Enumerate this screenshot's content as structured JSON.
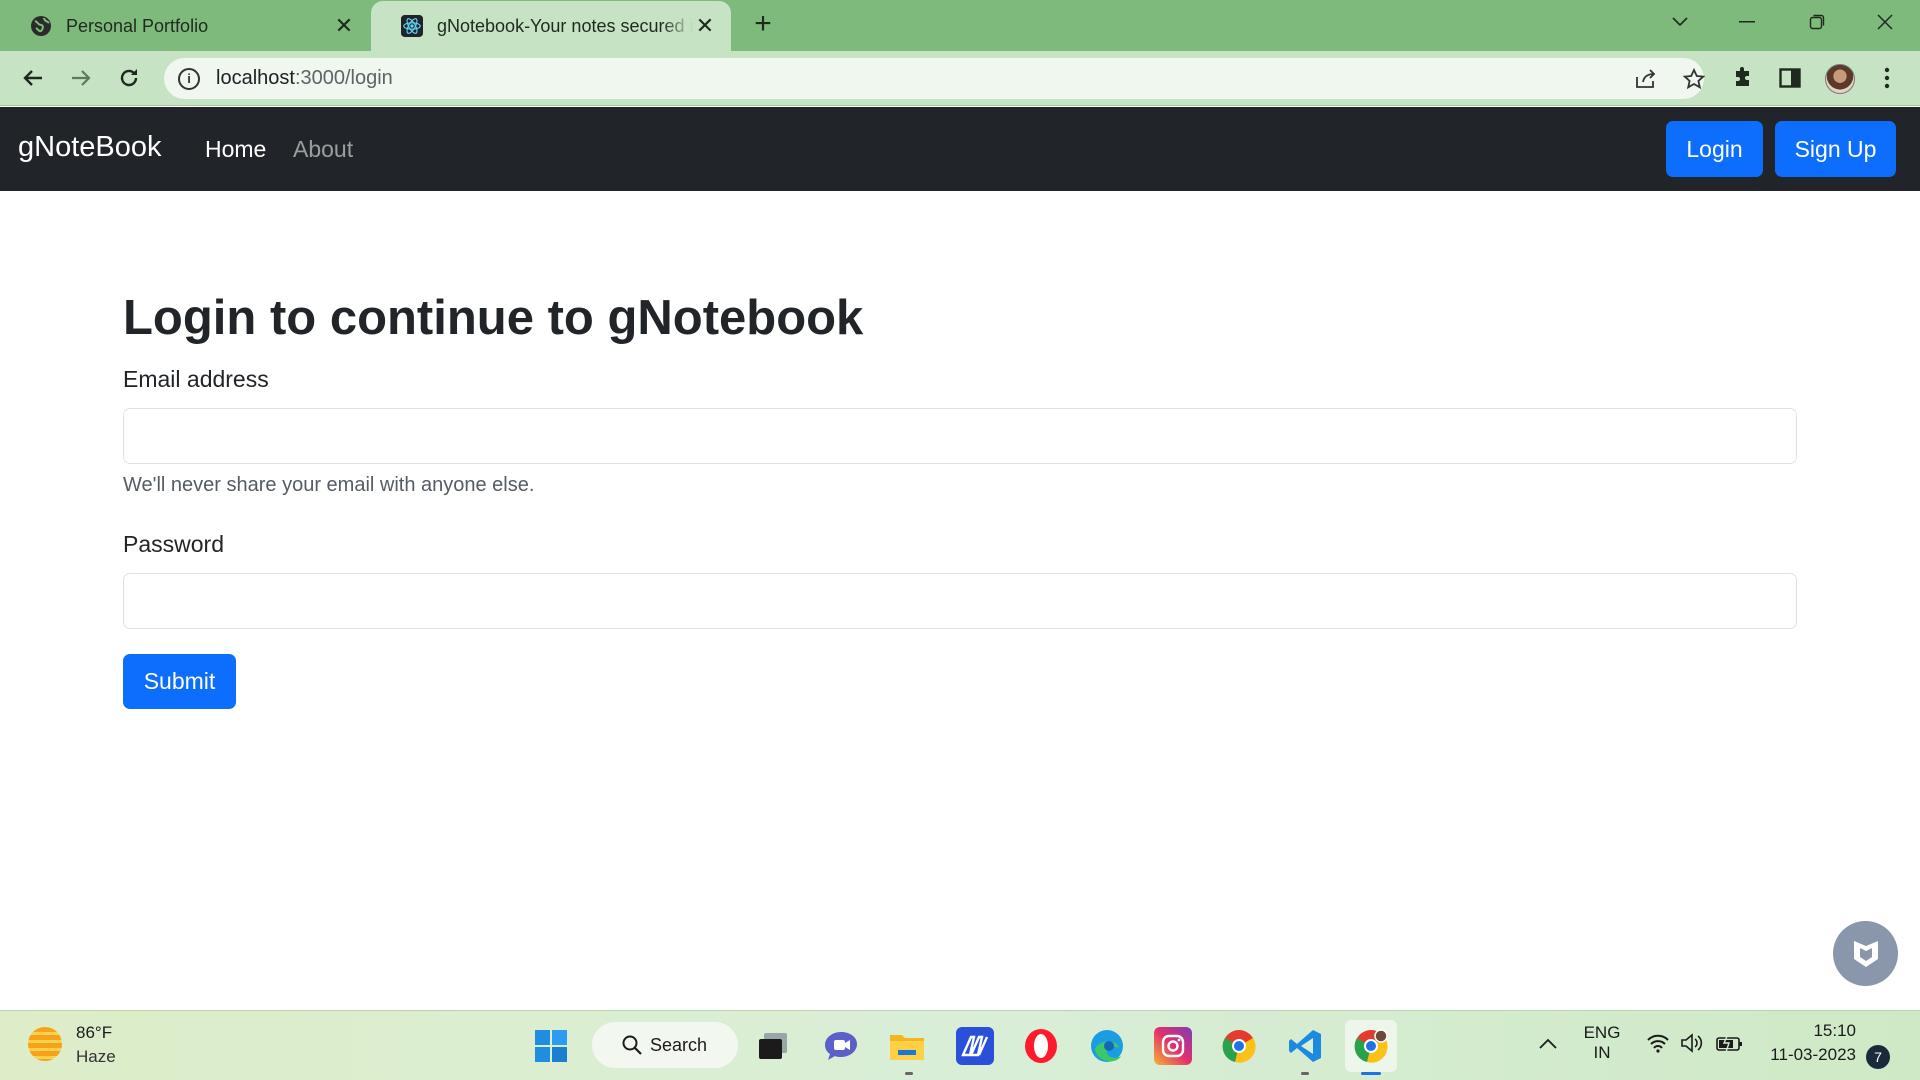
{
  "browser": {
    "tabs": [
      {
        "title": "Personal Portfolio",
        "active": false
      },
      {
        "title": "gNotebook-Your notes secured in the cloud",
        "active": true
      }
    ],
    "url_host": "localhost",
    "url_path": ":3000/login"
  },
  "navbar": {
    "brand": "gNoteBook",
    "links": [
      "Home",
      "About"
    ],
    "login_label": "Login",
    "signup_label": "Sign Up"
  },
  "page": {
    "heading": "Login to continue to gNotebook",
    "email_label": "Email address",
    "email_value": "",
    "email_help": "We'll never share your email with anyone else.",
    "password_label": "Password",
    "password_value": "",
    "submit_label": "Submit"
  },
  "taskbar": {
    "weather_temp": "86°F",
    "weather_desc": "Haze",
    "search_label": "Search",
    "lang_top": "ENG",
    "lang_bottom": "IN",
    "time": "15:10",
    "date": "11-03-2023",
    "notifications": "7"
  },
  "colors": {
    "tabstrip": "#7dba7b",
    "toolbar": "#c6e3c4",
    "navbar": "#212529",
    "primary": "#0d6efd"
  }
}
